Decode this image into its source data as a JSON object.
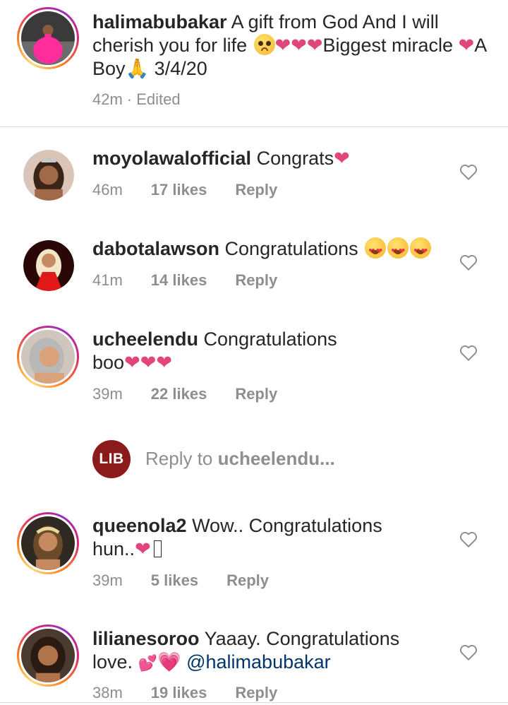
{
  "caption": {
    "username": "halimabubakar",
    "text_part1": "A gift from God And I will cherish you for life",
    "text_part2": "Biggest miracle",
    "text_part3": "A Boy",
    "text_part4": "3/4/20",
    "time": "42m",
    "edited": "· Edited"
  },
  "comments": [
    {
      "username": "moyolawalofficial",
      "text": "Congrats",
      "time": "46m",
      "likes": "17 likes",
      "reply": "Reply"
    },
    {
      "username": "dabotalawson",
      "text": "Congratulations",
      "time": "41m",
      "likes": "14 likes",
      "reply": "Reply"
    },
    {
      "username": "ucheelendu",
      "text": "Congratulations",
      "text2": "boo",
      "time": "39m",
      "likes": "22 likes",
      "reply": "Reply"
    },
    {
      "username": "queenola2",
      "text": "Wow.. Congratulations",
      "text2": "hun..",
      "time": "39m",
      "likes": "5 likes",
      "reply": "Reply"
    },
    {
      "username": "lilianesoroo",
      "text": "Yaaay. Congratulations",
      "text2": "love.",
      "mention": "@halimabubakar",
      "time": "38m",
      "likes": "19 likes",
      "reply": "Reply"
    }
  ],
  "reply_box": {
    "logo": "LIB",
    "prefix": "Reply to",
    "target": "ucheelendu..."
  },
  "colors": {
    "heart": "#e0457b",
    "muted": "#8e8e8e",
    "mention": "#003569",
    "lib": "#8b1a1a"
  }
}
